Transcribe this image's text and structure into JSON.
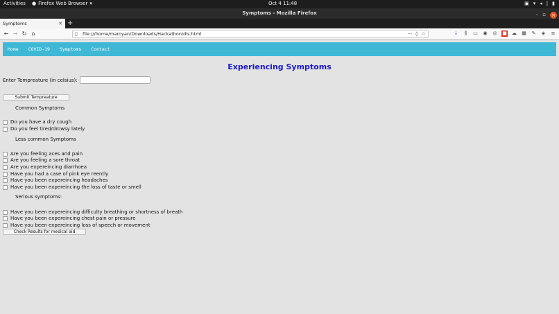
{
  "system_bar": {
    "activities": "Activities",
    "app_name": "Firefox Web Browser",
    "clock": "Oct 4  11:48"
  },
  "window": {
    "title": "Symptoms - Mozilla Firefox"
  },
  "browser": {
    "tab_title": "Symptoms",
    "url": "file:///home/maroyan/Downloads/Hackathon/dis.html"
  },
  "site": {
    "nav": [
      "Home",
      "COVID-19",
      "Symptoms",
      "Contact"
    ],
    "heading": "Experiencing Symptoms",
    "temperature_label": "Enter Tempreature (in celsius):",
    "temperature_value": "",
    "submit_label": "Submit Tempreature",
    "common_title": "Common Symptoms",
    "common": [
      "Do you have a dry cough",
      "Do you feel tired/drowsy lately"
    ],
    "less_common_title": "Less common Symptoms",
    "less_common": [
      "Are you feeling aces and pain",
      "Are you feeling a sore throat",
      "Are you expereincing diarrhoea",
      "Have you had a case of pink eye reently",
      "Have you been expereincing headaches",
      "Have you been expereincing the loss of taste or smell"
    ],
    "serious_title": "Serious symptoms:",
    "serious": [
      "Have you been expereincing difficulty breathing or shortness of breath",
      "Have you been expereincing chest pain or pressure",
      "Have you been expereincing loss of speech or movement"
    ],
    "check_label": "Check Results for medical aid"
  }
}
